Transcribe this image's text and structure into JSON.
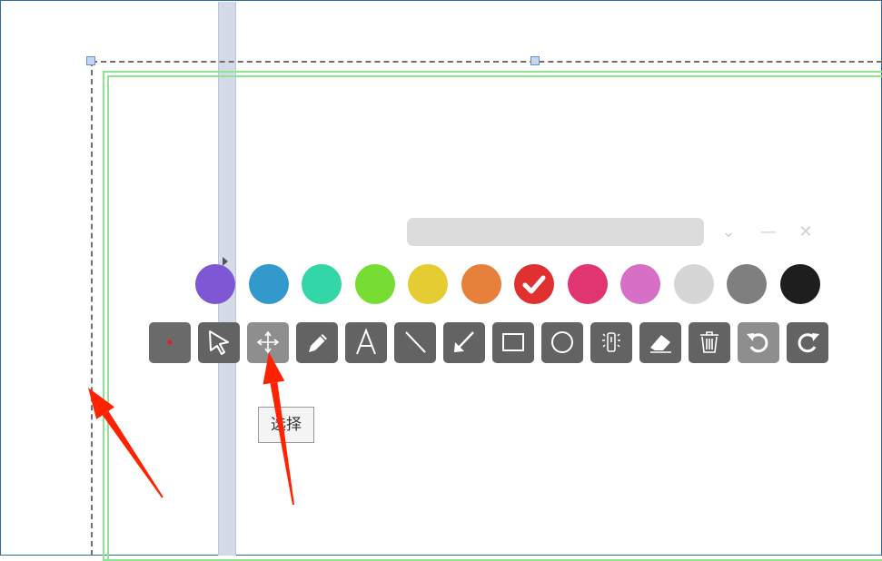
{
  "toolbar_window": {
    "title": "",
    "dropdown_icon": "chevron-down-icon",
    "minimize_icon": "minimize-icon",
    "close_icon": "close-icon"
  },
  "palette": {
    "colors": [
      "#7e57d4",
      "#3399cc",
      "#33d6a6",
      "#77dd33",
      "#e6cc33",
      "#e6803a",
      "#e03030",
      "#e03570",
      "#d86fc7",
      "#d6d6d6",
      "#7f7f7f",
      "#1e1e1e"
    ],
    "selected_index": 6
  },
  "tools": [
    {
      "name": "dot-pointer-tool",
      "icon": "red-dot-icon"
    },
    {
      "name": "cursor-tool",
      "icon": "cursor-arrow-icon"
    },
    {
      "name": "move-tool",
      "icon": "move-arrows-icon"
    },
    {
      "name": "pen-tool",
      "icon": "pencil-icon"
    },
    {
      "name": "text-tool",
      "icon": "text-a-icon"
    },
    {
      "name": "line-tool",
      "icon": "line-icon"
    },
    {
      "name": "arrow-tool",
      "icon": "arrow-icon"
    },
    {
      "name": "rectangle-tool",
      "icon": "rectangle-icon"
    },
    {
      "name": "ellipse-tool",
      "icon": "circle-icon"
    },
    {
      "name": "spotlight-tool",
      "icon": "spotlight-icon"
    },
    {
      "name": "eraser-tool",
      "icon": "eraser-icon"
    },
    {
      "name": "clear-tool",
      "icon": "trash-icon"
    },
    {
      "name": "undo-tool",
      "icon": "undo-icon"
    },
    {
      "name": "redo-tool",
      "icon": "redo-icon"
    }
  ],
  "tooltip": {
    "text": "选择"
  },
  "annotation_color": "#ff2200"
}
